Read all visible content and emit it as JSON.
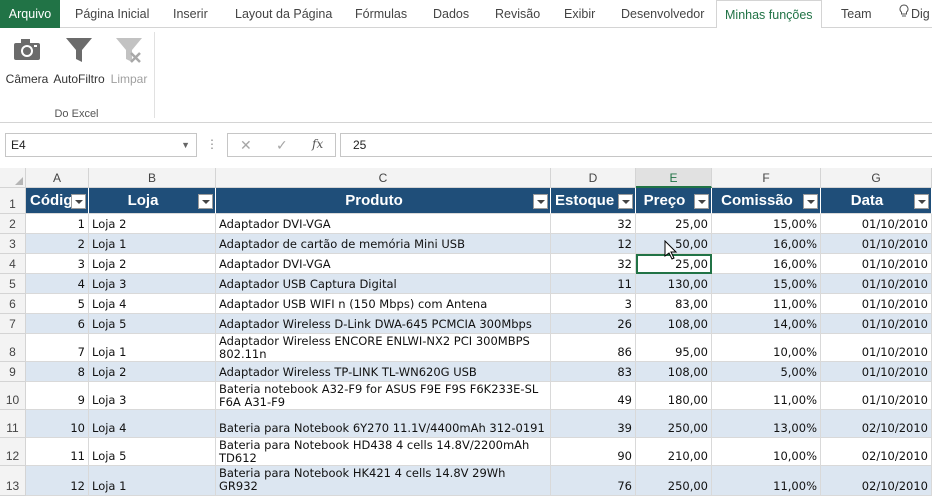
{
  "ribbon": {
    "tabs": [
      "Arquivo",
      "Página Inicial",
      "Inserir",
      "Layout da Página",
      "Fórmulas",
      "Dados",
      "Revisão",
      "Exibir",
      "Desenvolvedor",
      "Minhas funções",
      "Team",
      "Dig"
    ],
    "active_tab": "Minhas funções",
    "buttons": {
      "camera": "Câmera",
      "autofilter": "AutoFiltro",
      "clear": "Limpar"
    },
    "group_label": "Do Excel"
  },
  "formula_bar": {
    "name_box": "E4",
    "dots": "⋮",
    "cancel_icon": "✕",
    "enter_icon": "✓",
    "fx_icon": "fx",
    "value": "25"
  },
  "sheet": {
    "column_letters": [
      "A",
      "B",
      "C",
      "D",
      "E",
      "F",
      "G"
    ],
    "row_numbers": [
      "1",
      "2",
      "3",
      "4",
      "5",
      "6",
      "7",
      "8",
      "9",
      "10",
      "11",
      "12",
      "13"
    ],
    "headers": [
      "Código",
      "Loja",
      "Produto",
      "Estoque",
      "Preço",
      "Comissão",
      "Data"
    ],
    "rows": [
      {
        "code": "1",
        "loja": "Loja 2",
        "produto": [
          "Adaptador DVI-VGA"
        ],
        "estoque": "32",
        "preco": "25,00",
        "comissao": "15,00%",
        "data": "01/10/2010"
      },
      {
        "code": "2",
        "loja": "Loja 1",
        "produto": [
          "Adaptador de cartão de memória Mini USB"
        ],
        "estoque": "12",
        "preco": "50,00",
        "comissao": "16,00%",
        "data": "01/10/2010"
      },
      {
        "code": "3",
        "loja": "Loja 2",
        "produto": [
          "Adaptador DVI-VGA"
        ],
        "estoque": "32",
        "preco": "25,00",
        "comissao": "16,00%",
        "data": "01/10/2010"
      },
      {
        "code": "4",
        "loja": "Loja 3",
        "produto": [
          "Adaptador USB Captura Digital"
        ],
        "estoque": "11",
        "preco": "130,00",
        "comissao": "15,00%",
        "data": "01/10/2010"
      },
      {
        "code": "5",
        "loja": "Loja 4",
        "produto": [
          "Adaptador USB WIFI n (150 Mbps) com Antena"
        ],
        "estoque": "3",
        "preco": "83,00",
        "comissao": "11,00%",
        "data": "01/10/2010"
      },
      {
        "code": "6",
        "loja": "Loja 5",
        "produto": [
          "Adaptador Wireless D-Link DWA-645 PCMCIA 300Mbps"
        ],
        "estoque": "26",
        "preco": "108,00",
        "comissao": "14,00%",
        "data": "01/10/2010"
      },
      {
        "code": "7",
        "loja": "Loja 1",
        "produto": [
          "Adaptador Wireless ENCORE ENLWI-NX2 PCI 300MBPS",
          "802.11n"
        ],
        "estoque": "86",
        "preco": "95,00",
        "comissao": "10,00%",
        "data": "01/10/2010"
      },
      {
        "code": "8",
        "loja": "Loja 2",
        "produto": [
          "Adaptador Wireless TP-LINK TL-WN620G USB"
        ],
        "estoque": "83",
        "preco": "108,00",
        "comissao": "5,00%",
        "data": "01/10/2010"
      },
      {
        "code": "9",
        "loja": "Loja 3",
        "produto": [
          "Bateria notebook A32-F9 for ASUS F9E F9S F6K233E-SL",
          "F6A A31-F9"
        ],
        "estoque": "49",
        "preco": "180,00",
        "comissao": "11,00%",
        "data": "01/10/2010"
      },
      {
        "code": "10",
        "loja": "Loja 4",
        "produto": [
          "Bateria para Notebook 6Y270 11.1V/4400mAh 312-0191"
        ],
        "estoque": "39",
        "preco": "250,00",
        "comissao": "13,00%",
        "data": "02/10/2010"
      },
      {
        "code": "11",
        "loja": "Loja 5",
        "produto": [
          "Bateria para Notebook HD438 4 cells 14.8V/2200mAh",
          "TD612"
        ],
        "estoque": "90",
        "preco": "210,00",
        "comissao": "10,00%",
        "data": "02/10/2010"
      },
      {
        "code": "12",
        "loja": "Loja 1",
        "produto": [
          "Bateria para Notebook HK421 4 cells 14.8V 29Wh GR932"
        ],
        "estoque": "76",
        "preco": "250,00",
        "comissao": "11,00%",
        "data": "02/10/2010"
      }
    ]
  },
  "colors": {
    "excel_green": "#217346",
    "header_blue": "#1f4e79",
    "band_blue": "#dce6f1"
  }
}
